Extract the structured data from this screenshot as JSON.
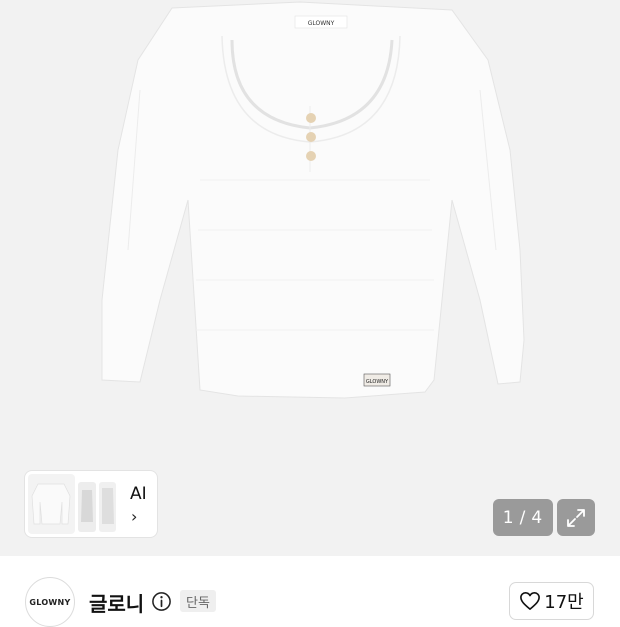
{
  "product_image": {
    "alt_icon": "white-henley-long-sleeve-top",
    "tag_text": "GLOWNY",
    "hem_tag_text": "GLOWNY"
  },
  "ai_card": {
    "label": "AI",
    "chevron": "›"
  },
  "gallery": {
    "current": "1",
    "separator": "/",
    "total": "4"
  },
  "brand": {
    "logo_text": "GLOWNY",
    "name": "글로니",
    "badge": "단독",
    "likes": "17만"
  },
  "colors": {
    "hero_bg": "#f2f2f2",
    "counter_bg": "#9a9a9a",
    "badge_bg": "#efefef"
  }
}
